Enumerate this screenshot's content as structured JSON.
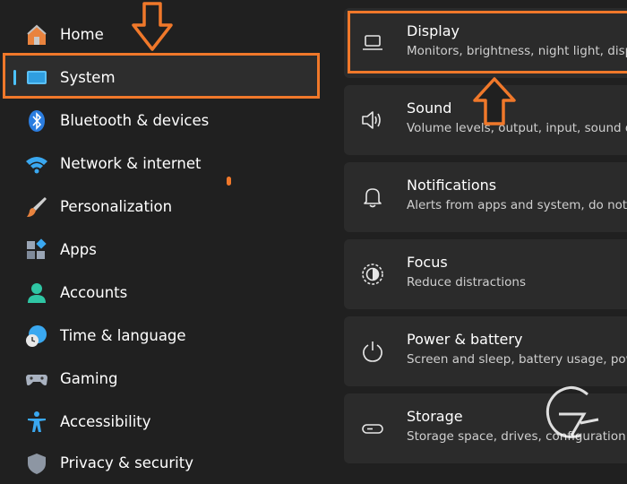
{
  "sidebar": {
    "items": [
      {
        "label": "Home",
        "icon": "home-icon"
      },
      {
        "label": "System",
        "icon": "system-icon",
        "selected": true
      },
      {
        "label": "Bluetooth & devices",
        "icon": "bluetooth-icon"
      },
      {
        "label": "Network & internet",
        "icon": "wifi-icon"
      },
      {
        "label": "Personalization",
        "icon": "brush-icon"
      },
      {
        "label": "Apps",
        "icon": "apps-icon"
      },
      {
        "label": "Accounts",
        "icon": "account-icon"
      },
      {
        "label": "Time & language",
        "icon": "globe-clock-icon"
      },
      {
        "label": "Gaming",
        "icon": "gamepad-icon"
      },
      {
        "label": "Accessibility",
        "icon": "accessibility-icon"
      },
      {
        "label": "Privacy & security",
        "icon": "shield-icon"
      }
    ]
  },
  "main": {
    "cards": [
      {
        "title": "Display",
        "subtitle": "Monitors, brightness, night light, disp",
        "icon": "monitor-icon"
      },
      {
        "title": "Sound",
        "subtitle": "Volume levels, output, input, sound de",
        "icon": "speaker-icon"
      },
      {
        "title": "Notifications",
        "subtitle": "Alerts from apps and system, do not d",
        "icon": "bell-icon"
      },
      {
        "title": "Focus",
        "subtitle": "Reduce distractions",
        "icon": "focus-icon"
      },
      {
        "title": "Power & battery",
        "subtitle": "Screen and sleep, battery usage, powe",
        "icon": "power-icon"
      },
      {
        "title": "Storage",
        "subtitle": "Storage space, drives, configuration ru",
        "icon": "storage-icon"
      }
    ]
  },
  "colors": {
    "accent": "#4cc2ff",
    "annotation": "#f0782a",
    "background": "#202020",
    "card": "#2b2b2b"
  }
}
